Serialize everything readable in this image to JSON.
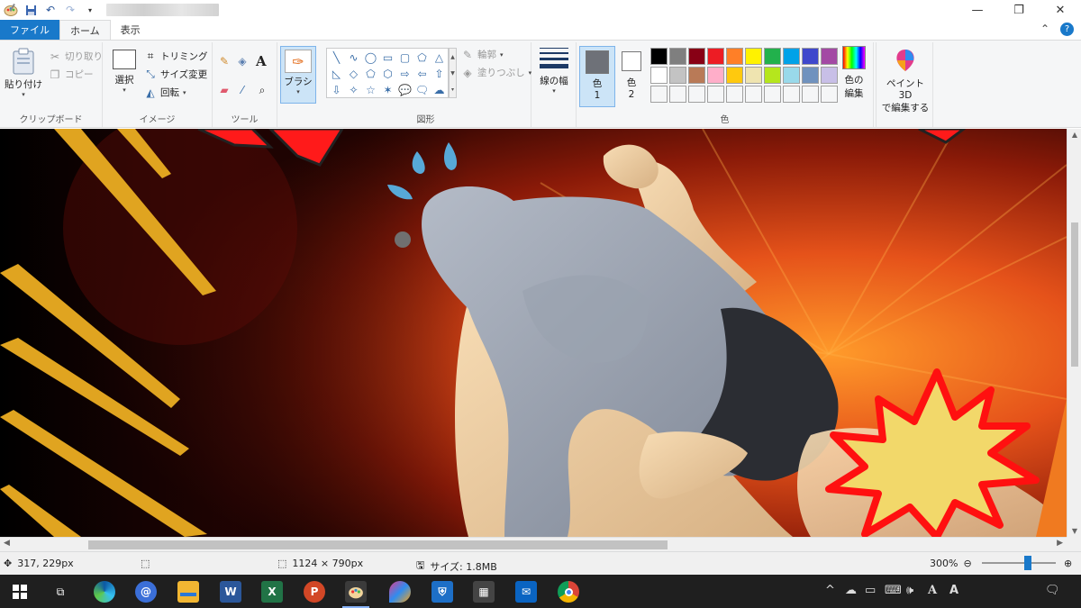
{
  "window": {
    "quick_access": [
      "paint-app-icon",
      "save-icon",
      "undo-icon",
      "redo-icon",
      "qat-dropdown-icon"
    ],
    "controls": {
      "minimize": "—",
      "maximize": "❐",
      "close": "✕"
    }
  },
  "tabs": [
    {
      "label": "ファイル"
    },
    {
      "label": "ホーム"
    },
    {
      "label": "表示"
    }
  ],
  "ribbon": {
    "clipboard": {
      "paste": "貼り付け",
      "cut": "切り取り",
      "copy": "コピー",
      "label": "クリップボード"
    },
    "image": {
      "select": "選択",
      "crop": "トリミング",
      "resize": "サイズ変更",
      "rotate": "回転",
      "label": "イメージ"
    },
    "tools": {
      "label": "ツール",
      "brush": "ブラシ"
    },
    "shapes": {
      "outline": "輪郭",
      "fill": "塗りつぶし",
      "label": "図形",
      "glyphs": [
        "╲",
        "∿",
        "◯",
        "▭",
        "▢",
        "⬠",
        "△",
        "◺",
        "◇",
        "⬠",
        "⬡",
        "⇨",
        "⇦",
        "⇧",
        "⇩",
        "✧",
        "☆",
        "✶",
        "💬",
        "🗨",
        "☁"
      ]
    },
    "line_width": "線の幅",
    "colors": {
      "color1_a": "色",
      "color1_b": "1",
      "color2_a": "色",
      "color2_b": "2",
      "color1": "#6e7178",
      "color2": "#ffffff",
      "palette": [
        "#000000",
        "#7f7f7f",
        "#880015",
        "#ed1c24",
        "#ff7f27",
        "#fff200",
        "#22b14c",
        "#00a2e8",
        "#3f48cc",
        "#a349a4",
        "#ffffff",
        "#c3c3c3",
        "#b97a57",
        "#ffaec9",
        "#ffc90e",
        "#efe4b0",
        "#b5e61d",
        "#99d9ea",
        "#7092be",
        "#c8bfe7",
        "#f5f6f7",
        "#f5f6f7",
        "#f5f6f7",
        "#f5f6f7",
        "#f5f6f7",
        "#f5f6f7",
        "#f5f6f7",
        "#f5f6f7",
        "#f5f6f7",
        "#f5f6f7"
      ],
      "edit_a": "色の",
      "edit_b": "編集",
      "label": "色"
    },
    "paint3d_a": "ペイント 3D",
    "paint3d_b": "で編集する"
  },
  "status": {
    "cursor": "317, 229px",
    "dimensions": "1124 × 790px",
    "size": "サイズ: 1.8MB",
    "zoom": "300%"
  },
  "taskbar": {
    "apps": [
      "windows-start",
      "task-view",
      "edge",
      "mail-menu",
      "file-explorer",
      "word",
      "excel",
      "powerpoint",
      "paint",
      "paint-3d",
      "defender",
      "calculator",
      "mail",
      "chrome"
    ],
    "word_letter": "W",
    "excel_letter": "X",
    "ppt_letter": "P"
  }
}
